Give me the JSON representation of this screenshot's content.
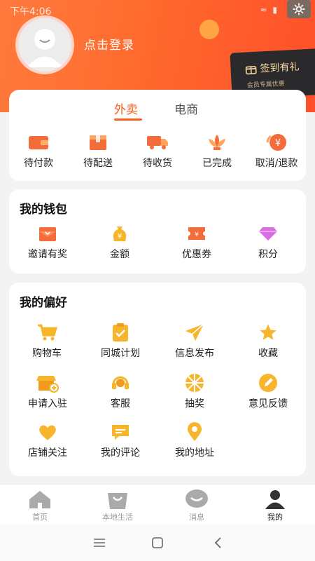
{
  "status": {
    "time": "下午4:06",
    "icons": "≈ ▮"
  },
  "profile": {
    "login_text": "点击登录"
  },
  "signin": {
    "label": "签到有礼",
    "sub": "会员专属优惠"
  },
  "orders": {
    "tabs": [
      {
        "label": "外卖"
      },
      {
        "label": "电商"
      }
    ],
    "items": [
      {
        "label": "待付款",
        "icon": "wallet-icon"
      },
      {
        "label": "待配送",
        "icon": "package-icon"
      },
      {
        "label": "待收货",
        "icon": "truck-icon"
      },
      {
        "label": "已完成",
        "icon": "lotus-icon"
      },
      {
        "label": "取消/退款",
        "icon": "refund-icon"
      }
    ]
  },
  "wallet": {
    "title": "我的钱包",
    "items": [
      {
        "label": "邀请有奖",
        "icon": "envelope-heart-icon"
      },
      {
        "label": "金额",
        "icon": "money-bag-icon"
      },
      {
        "label": "优惠券",
        "icon": "coupon-icon"
      },
      {
        "label": "积分",
        "icon": "diamond-icon"
      }
    ]
  },
  "preferences": {
    "title": "我的偏好",
    "items": [
      {
        "label": "购物车",
        "icon": "cart-icon"
      },
      {
        "label": "同城计划",
        "icon": "clipboard-check-icon"
      },
      {
        "label": "信息发布",
        "icon": "paper-plane-icon"
      },
      {
        "label": "收藏",
        "icon": "star-icon"
      },
      {
        "label": "申请入驻",
        "icon": "store-plus-icon"
      },
      {
        "label": "客服",
        "icon": "headset-icon"
      },
      {
        "label": "抽奖",
        "icon": "prize-wheel-icon"
      },
      {
        "label": "意见反馈",
        "icon": "pencil-icon"
      },
      {
        "label": "店铺关注",
        "icon": "heart-icon"
      },
      {
        "label": "我的评论",
        "icon": "comment-icon"
      },
      {
        "label": "我的地址",
        "icon": "location-pin-icon"
      }
    ]
  },
  "tabbar": [
    {
      "label": "首页",
      "icon": "home-icon"
    },
    {
      "label": "本地生活",
      "icon": "shopping-bag-icon"
    },
    {
      "label": "消息",
      "icon": "message-bubble-icon"
    },
    {
      "label": "我的",
      "icon": "person-icon",
      "active": true
    }
  ],
  "colors": {
    "accent": "#ff5a1f",
    "header_start": "#ff7a3d",
    "header_end": "#ff4f2a",
    "icon_yellow": "#f7b52c",
    "icon_orange": "#f36c3a"
  }
}
